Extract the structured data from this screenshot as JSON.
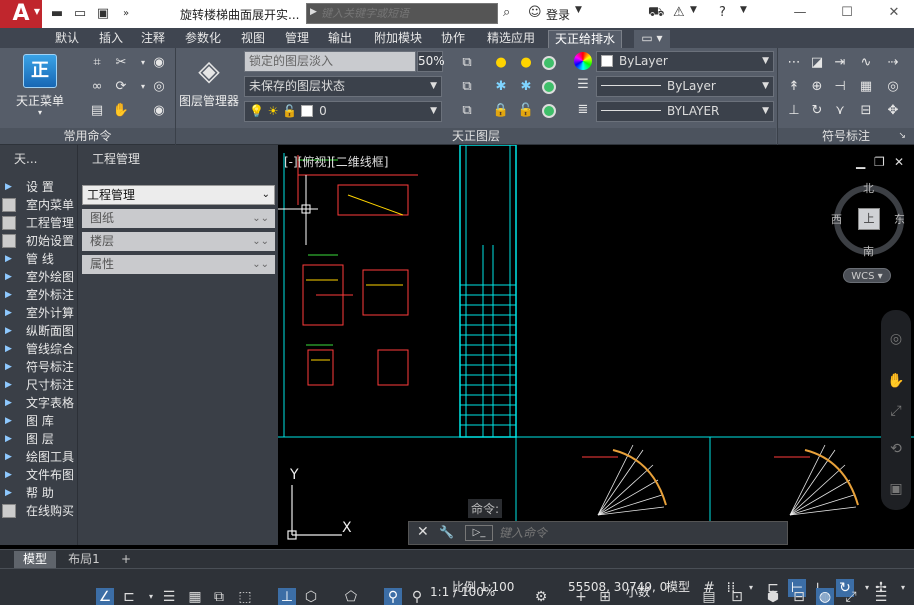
{
  "title_bar": {
    "app_logo": "A",
    "doc_title": "旋转楼梯曲面展开实...",
    "search_placeholder": "键入关键字或短语",
    "login_label": "登录"
  },
  "ribbon_tabs": [
    "默认",
    "插入",
    "注释",
    "参数化",
    "视图",
    "管理",
    "输出",
    "附加模块",
    "协作",
    "精选应用",
    "天正给排水"
  ],
  "active_tab": "天正给排水",
  "ribbon": {
    "panel_common": "常用命令",
    "tz_menu_label": "天正菜单",
    "panel_layers": "天正图层",
    "layer_manager_label": "图层管理器",
    "lock_fade_label": "锁定的图层淡入",
    "lock_fade_value": "50%",
    "layer_state": "未保存的图层状态",
    "current_layer": "0",
    "color_value": "ByLayer",
    "linetype_value": "ByLayer",
    "lineweight_value": "BYLAYER",
    "panel_symbols": "符号标注"
  },
  "left_palette": {
    "title": "天...",
    "items": [
      {
        "label": "设    置",
        "mark": "▶"
      },
      {
        "label": "室内菜单",
        "mark": ""
      },
      {
        "label": "工程管理",
        "mark": ""
      },
      {
        "label": "初始设置",
        "mark": ""
      },
      {
        "label": "管    线",
        "mark": "▶"
      },
      {
        "label": "室外绘图",
        "mark": "▶"
      },
      {
        "label": "室外标注",
        "mark": "▶"
      },
      {
        "label": "室外计算",
        "mark": "▶"
      },
      {
        "label": "纵断面图",
        "mark": "▶"
      },
      {
        "label": "管线综合",
        "mark": "▶"
      },
      {
        "label": "符号标注",
        "mark": "▶"
      },
      {
        "label": "尺寸标注",
        "mark": "▶"
      },
      {
        "label": "文字表格",
        "mark": "▶"
      },
      {
        "label": "图    库",
        "mark": "▶"
      },
      {
        "label": "图    层",
        "mark": "▶"
      },
      {
        "label": "绘图工具",
        "mark": "▶"
      },
      {
        "label": "文件布图",
        "mark": "▶"
      },
      {
        "label": "帮    助",
        "mark": "▶"
      },
      {
        "label": "在线购买",
        "mark": ""
      }
    ]
  },
  "project_panel": {
    "title": "工程管理",
    "select_value": "工程管理",
    "sections": [
      "图纸",
      "楼层",
      "属性"
    ]
  },
  "canvas": {
    "viewport_label": "[-][俯视][二维线框]",
    "compass": {
      "n": "北",
      "s": "南",
      "e": "东",
      "w": "西",
      "face": "上"
    },
    "wcs": "WCS",
    "command_label": "命令:",
    "command_placeholder": "键入命令"
  },
  "layout_tabs": [
    "模型",
    "布局1"
  ],
  "statusbar": {
    "scale": "比例 1:100",
    "coords": "55508, 30749, 0",
    "space": "模型",
    "annotation_scale": "1:1 / 100%",
    "units": "小数"
  },
  "colors": {
    "cyan": "#00e5e5",
    "cad_red": "#ff3b3b",
    "cad_yellow": "#ffd400",
    "ribbon_bg": "#565d69"
  }
}
